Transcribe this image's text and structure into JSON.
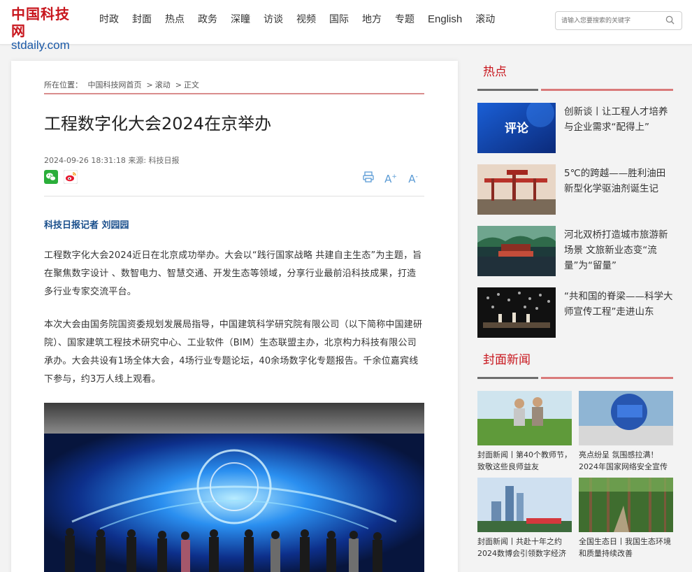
{
  "header": {
    "logo_cn": "中国科技网",
    "logo_en": "stdaily.com",
    "nav": [
      "时政",
      "封面",
      "热点",
      "政务",
      "深瞳",
      "访谈",
      "视频",
      "国际",
      "地方",
      "专题",
      "English",
      "滚动"
    ],
    "search_placeholder": "请输入您要搜索的关键字"
  },
  "article": {
    "breadcrumb": {
      "prefix": "所在位置：",
      "home": "中国科技网首页",
      "section": "滚动",
      "current": "正文"
    },
    "title": "工程数字化大会2024在京举办",
    "meta": "2024-09-26 18:31:18 来源: 科技日报",
    "reporter": "科技日报记者 刘园园",
    "paragraphs": [
      "工程数字化大会2024近日在北京成功举办。大会以“践行国家战略 共建自主生态”为主题，旨在聚焦数字设计 、数智电力、智慧交通、开发生态等领域，分享行业最前沿科技成果，打造多行业专家交流平台。",
      "本次大会由国务院国资委规划发展局指导，中国建筑科学研究院有限公司（以下简称中国建研院）、国家建筑工程技术研究中心、工业软件（BIM）生态联盟主办，北京构力科技有限公司承办。大会共设有1场全体大会，4场行业专题论坛，40余场数字化专题报告。千余位嘉宾线下参与，约3万人线上观看。"
    ],
    "tools": {
      "print": "print",
      "font_up": "A",
      "font_down": "A"
    }
  },
  "sidebar": {
    "hot_title": "热点",
    "hot_items": [
      {
        "text": "创新谈丨让工程人才培养与企业需求“配得上”",
        "thumb_label": "评论"
      },
      {
        "text": "5℃的跨越——胜利油田新型化学驱油剂诞生记"
      },
      {
        "text": "河北双桥打造城市旅游新场景 文旅新业态变“流量”为“留量”"
      },
      {
        "text": "“共和国的脊梁——科学大师宣传工程”走进山东"
      }
    ],
    "cover_title": "封面新闻",
    "cover_items": [
      {
        "text": "封面新闻丨第40个教师节，致敬这些良师益友"
      },
      {
        "text": "亮点纷呈 氛围感拉满！2024年国家网络安全宣传"
      },
      {
        "text": "封面新闻丨共赴十年之约 2024数博会引领数字经济"
      },
      {
        "text": "全国生态日丨我国生态环境和质量持续改善"
      }
    ]
  },
  "colors": {
    "brand_red": "#c8161d",
    "link_blue": "#1a4f8c"
  }
}
